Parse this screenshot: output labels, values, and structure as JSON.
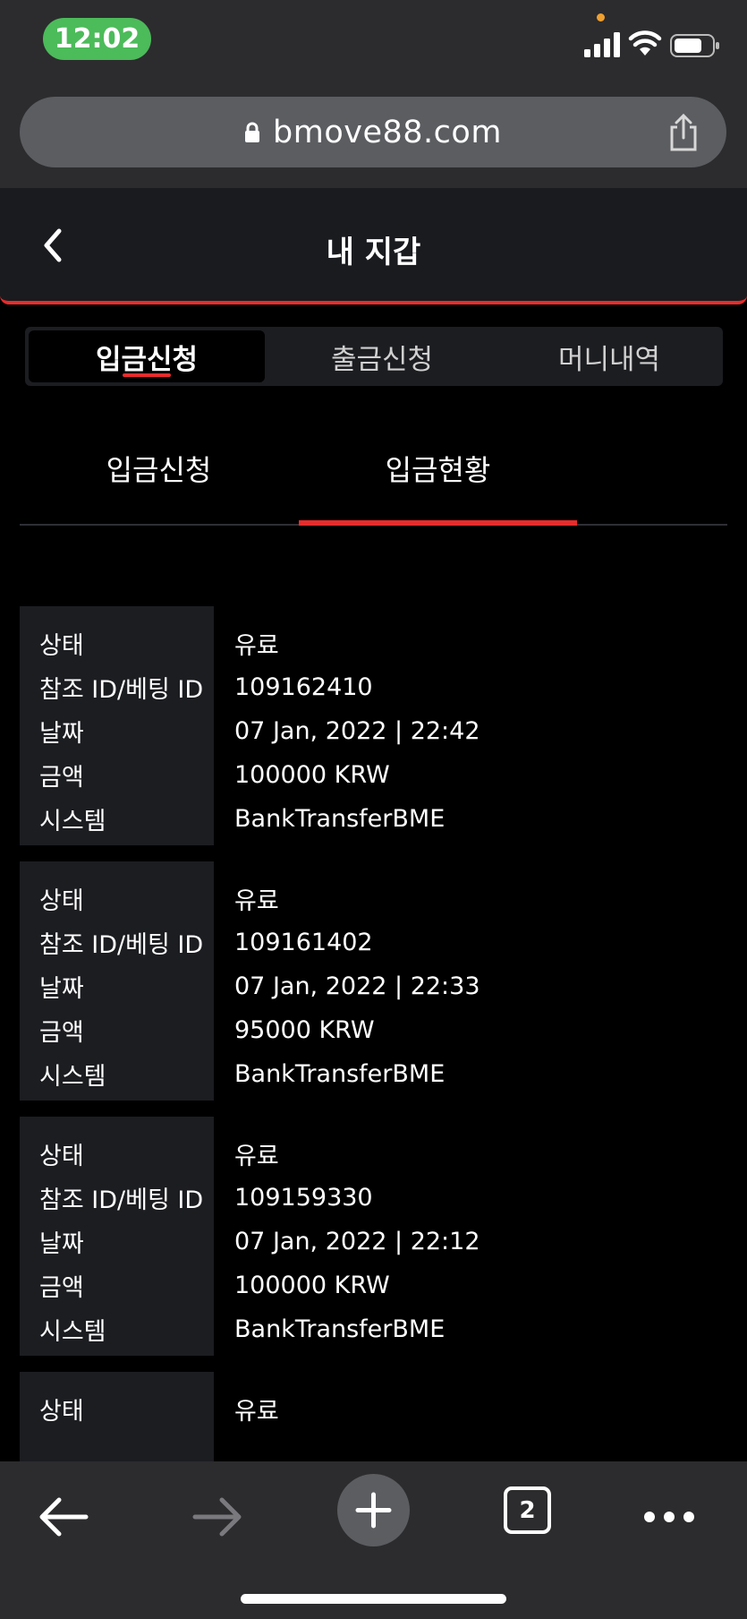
{
  "status_bar": {
    "time": "12:02"
  },
  "browser": {
    "url": "bmove88.com",
    "open_tabs": "2"
  },
  "header": {
    "title": "내 지갑"
  },
  "main_tabs": [
    {
      "label": "입금신청",
      "active": true
    },
    {
      "label": "출금신청",
      "active": false
    },
    {
      "label": "머니내역",
      "active": false
    }
  ],
  "sub_tabs": [
    {
      "label": "입금신청",
      "active": false
    },
    {
      "label": "입금현황",
      "active": true
    }
  ],
  "field_labels": {
    "status": "상태",
    "ref_id": "참조 ID/베팅 ID",
    "date": "날짜",
    "amount": "금액",
    "system": "시스템"
  },
  "records": [
    {
      "status": "유료",
      "ref_id": "109162410",
      "date": "07 Jan, 2022 | 22:42",
      "amount": "100000 KRW",
      "system": "BankTransferBME"
    },
    {
      "status": "유료",
      "ref_id": "109161402",
      "date": "07 Jan, 2022 | 22:33",
      "amount": "95000 KRW",
      "system": "BankTransferBME"
    },
    {
      "status": "유료",
      "ref_id": "109159330",
      "date": "07 Jan, 2022 | 22:12",
      "amount": "100000 KRW",
      "system": "BankTransferBME"
    },
    {
      "status": "유료"
    }
  ],
  "colors": {
    "accent": "#e62c2c",
    "label_bg": "#1c1d21",
    "time_pill": "#4cbb5a"
  }
}
